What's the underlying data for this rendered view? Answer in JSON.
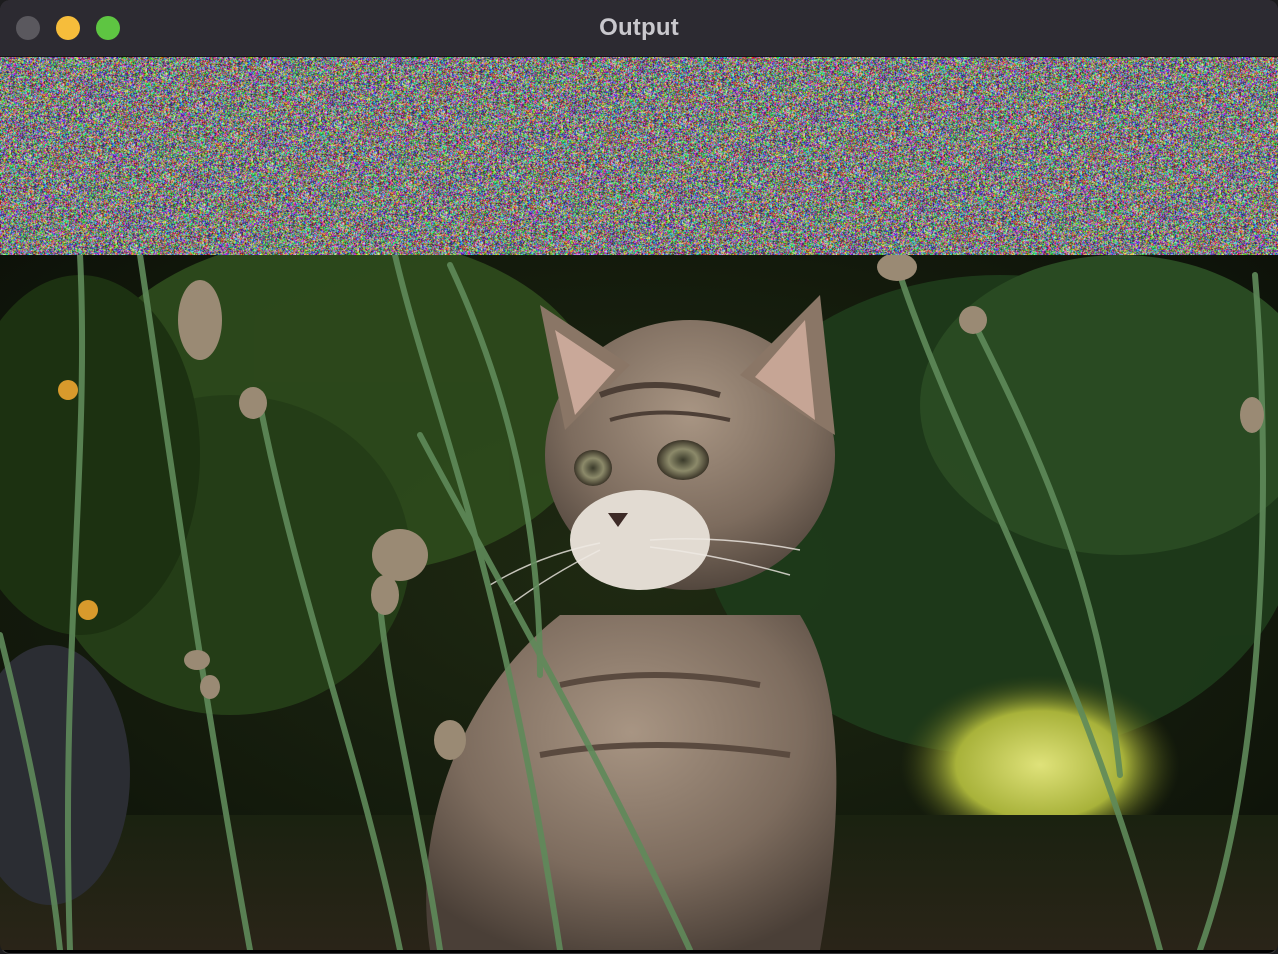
{
  "window": {
    "title": "Output",
    "controls": {
      "close_color": "#5a585e",
      "minimize_color": "#f6bd3b",
      "zoom_color": "#5ec542"
    }
  },
  "content": {
    "noise_region": {
      "description_icon": "random-noise-pattern"
    },
    "image_region": {
      "subject_icon": "kitten-in-grass-photo"
    }
  }
}
